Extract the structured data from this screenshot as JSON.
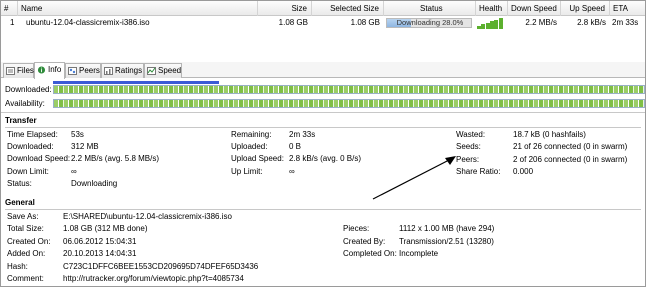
{
  "list": {
    "headers": [
      "#",
      "Name",
      "Size",
      "Selected Size",
      "Status",
      "Health",
      "Down Speed",
      "Up Speed",
      "ETA"
    ],
    "row": {
      "index": "1",
      "name": "ubuntu-12.04-classicremix-i386.iso",
      "size": "1.08 GB",
      "selected_size": "1.08 GB",
      "status_text": "Downloading 28.0%",
      "progress": 0.28,
      "health_level": 6,
      "down_speed": "2.2 MB/s",
      "up_speed": "2.8 kB/s",
      "eta": "2m 33s"
    }
  },
  "tabs": [
    {
      "label": "Files",
      "icon": "files-icon"
    },
    {
      "label": "Info",
      "icon": "info-icon"
    },
    {
      "label": "Peers",
      "icon": "peers-icon"
    },
    {
      "label": "Ratings",
      "icon": "ratings-icon"
    },
    {
      "label": "Speed",
      "icon": "speed-icon"
    }
  ],
  "pieces": {
    "downloaded_label": "Downloaded:",
    "availability_label": "Availability:",
    "downloaded_fraction": 0.28
  },
  "transfer": {
    "title": "Transfer",
    "time_elapsed_label": "Time Elapsed:",
    "time_elapsed": "53s",
    "downloaded_label": "Downloaded:",
    "downloaded": "312 MB",
    "download_speed_label": "Download Speed:",
    "download_speed": "2.2 MB/s (avg. 5.8 MB/s)",
    "down_limit_label": "Down Limit:",
    "down_limit": "∞",
    "status_label": "Status:",
    "status": "Downloading",
    "remaining_label": "Remaining:",
    "remaining": "2m 33s",
    "uploaded_label": "Uploaded:",
    "uploaded": "0 B",
    "upload_speed_label": "Upload Speed:",
    "upload_speed": "2.8 kB/s (avg. 0 B/s)",
    "up_limit_label": "Up Limit:",
    "up_limit": "∞",
    "wasted_label": "Wasted:",
    "wasted": "18.7 kB (0 hashfails)",
    "seeds_label": "Seeds:",
    "seeds": "21 of 26 connected (0 in swarm)",
    "peers_label": "Peers:",
    "peers": "2 of 206 connected (0 in swarm)",
    "share_ratio_label": "Share Ratio:",
    "share_ratio": "0.000"
  },
  "general": {
    "title": "General",
    "save_as_label": "Save As:",
    "save_as": "E:\\SHARED\\ubuntu-12.04-classicremix-i386.iso",
    "total_size_label": "Total Size:",
    "total_size": "1.08 GB (312 MB done)",
    "created_on_label": "Created On:",
    "created_on": "06.06.2012 15:04:31",
    "added_on_label": "Added On:",
    "added_on": "20.10.2013 14:04:31",
    "hash_label": "Hash:",
    "hash": "C723C1DFFC6BEE1553CD209695D74DFEF65D3436",
    "comment_label": "Comment:",
    "comment": "http://rutracker.org/forum/viewtopic.php?t=4085734",
    "pieces_label": "Pieces:",
    "pieces": "1112 x 1.00 MB (have 294)",
    "created_by_label": "Created By:",
    "created_by": "Transmission/2.51 (13280)",
    "completed_on_label": "Completed On:",
    "completed_on": "Incomplete"
  },
  "colors": {
    "progress": "#3b5bd6",
    "pieces": "#9acd66",
    "health": "#5cb02e"
  }
}
